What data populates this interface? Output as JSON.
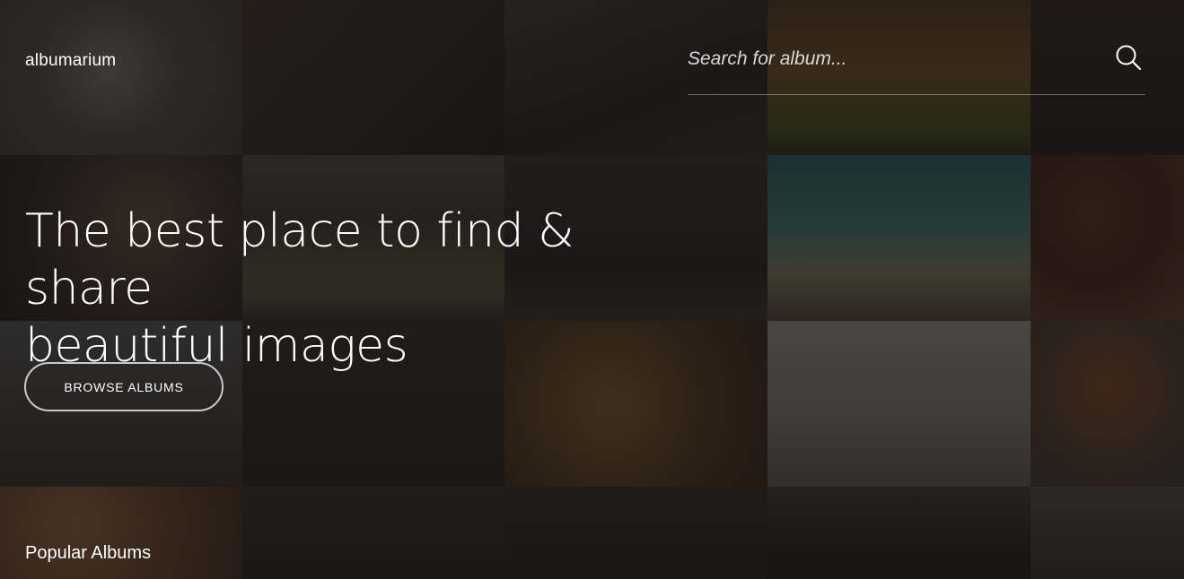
{
  "header": {
    "logo": "albumarium",
    "search": {
      "placeholder": "Search for album...",
      "icon": "search-icon"
    }
  },
  "hero": {
    "headline_line1": "The best place to find & share",
    "headline_line2": "beautiful images",
    "cta_label": "BROWSE ALBUMS"
  },
  "popular": {
    "title": "Popular Albums"
  },
  "background_tiles": [
    "dog",
    "cat-on-chair",
    "ornate-ironwork",
    "sandwich",
    "food",
    "woman-portrait",
    "wooden-bridge",
    "forest-path",
    "camper-van-beach",
    "couple",
    "city-rooftops",
    "apartment-building",
    "lion-and-tiger",
    "pelican-pier",
    "red-haired-woman",
    "puppy",
    "dark-scene",
    "dark-scene",
    "forest-treeline",
    "street-scene"
  ],
  "colors": {
    "text": "#ffffff",
    "background": "#1e1a17"
  }
}
